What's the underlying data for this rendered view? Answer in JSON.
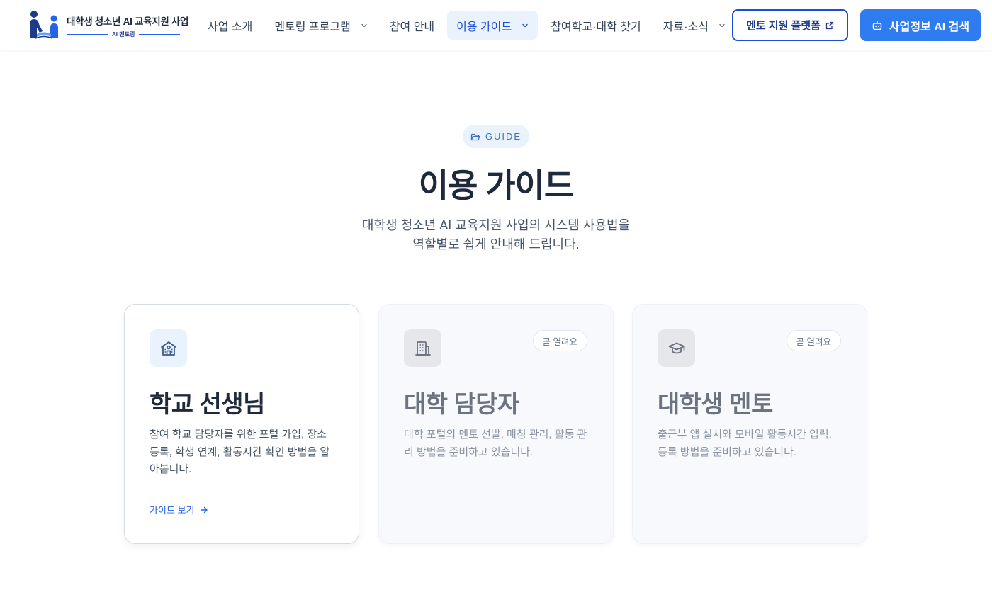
{
  "logo": {
    "title": "대학생 청소년 AI 교육지원 사업",
    "subtitle": "AI 멘토링"
  },
  "nav": {
    "items": [
      {
        "label": "사업 소개"
      },
      {
        "label": "멘토링 프로그램"
      },
      {
        "label": "참여 안내"
      },
      {
        "label": "이용 가이드"
      },
      {
        "label": "참여학교·대학 찾기"
      },
      {
        "label": "자료·소식"
      }
    ],
    "active": "이용 가이드"
  },
  "header_buttons": {
    "mentor_platform": "멘토 지원 플랫폼",
    "ai_search": "사업정보 AI 검색"
  },
  "hero": {
    "badge": "GUIDE",
    "title": "이용 가이드",
    "desc_line1": "대학생 청소년 AI 교육지원 사업의 시스템 사용법을",
    "desc_line2": "역할별로 쉽게 안내해 드립니다."
  },
  "cards": [
    {
      "title": "학교 선생님",
      "desc": "참여 학교 담당자를 위한 포털 가입, 장소 등록, 학생 연계, 활동시간 확인 방법을 알아봅니다.",
      "link": "가이드 보기",
      "icon": "school-icon"
    },
    {
      "title": "대학 담당자",
      "desc": "대학 포털의 멘토 선발, 매칭 관리, 활동 관리 방법을 준비하고 있습니다.",
      "badge": "곧 열려요",
      "icon": "building-icon"
    },
    {
      "title": "대학생 멘토",
      "desc": "출근부 앱 설치와 모바일 활동시간 입력, 등록 방법을 준비하고 있습니다.",
      "badge": "곧 열려요",
      "icon": "graduation-cap-icon"
    }
  ],
  "colors": {
    "primary": "#2f7cf0",
    "navy": "#1e3a8a",
    "active_bg": "#eaf2fd",
    "text_dark": "#1e293b"
  }
}
